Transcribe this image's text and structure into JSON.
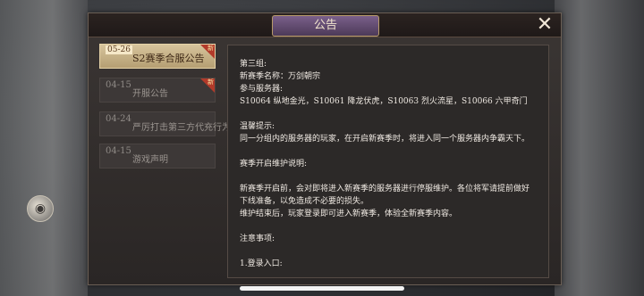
{
  "dialog": {
    "title": "公告",
    "close_icon": "✕"
  },
  "sidebar": {
    "items": [
      {
        "date": "05-26",
        "label": "S2赛季合服公告",
        "new_badge": "新",
        "active": true
      },
      {
        "date": "04-15",
        "label": "开服公告",
        "new_badge": "新",
        "active": false
      },
      {
        "date": "04-24",
        "label": "严厉打击第三方代充行为",
        "new_badge": "",
        "active": false
      },
      {
        "date": "04-15",
        "label": "游戏声明",
        "new_badge": "",
        "active": false
      }
    ]
  },
  "content": {
    "lines": [
      "第三组:",
      "新赛季名称：万剑朝宗",
      "参与服务器:",
      "S10064 纵地金光，S10061 降龙伏虎，S10063 烈火流星，S10066 六甲奇门",
      "",
      "温馨提示:",
      "同一分组内的服务器的玩家，在开启新赛季时，将进入同一个服务器内争霸天下。",
      "",
      "赛季开启维护说明:",
      "",
      "新赛季开启前，会对即将进入新赛季的服务器进行停服维护。各位将军请提前做好",
      "下线准备，以免造成不必要的损失。",
      "维护结束后，玩家登录即可进入新赛季，体验全新赛季内容。",
      "",
      "注意事项:",
      "",
      "1.登录入口:"
    ]
  },
  "colors": {
    "accent_gold": "#d7c49c",
    "badge_red": "#b23a2a",
    "title_purple": "#6a4f7a"
  }
}
